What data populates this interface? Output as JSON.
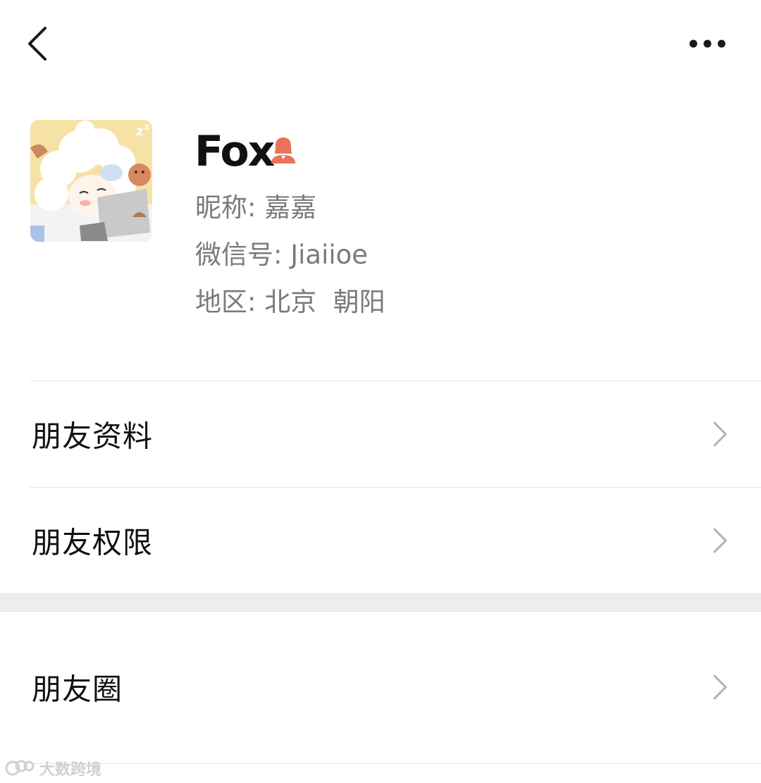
{
  "header": {
    "back_icon": "chevron-left-icon",
    "more_icon": "ellipsis-icon"
  },
  "profile": {
    "name": "Fox",
    "gender_icon": "female-person-icon",
    "gender_color": "#e8735a",
    "nickname_label": "昵称:",
    "nickname": "嘉嘉",
    "wechat_id_label": "微信号:",
    "wechat_id": "Jiaiioe",
    "region_label": "地区:",
    "region": "北京  朝阳"
  },
  "menu": {
    "friend_info": "朋友资料",
    "friend_permissions": "朋友权限",
    "moments": "朋友圈"
  },
  "watermark": {
    "text": "大数跨境"
  }
}
